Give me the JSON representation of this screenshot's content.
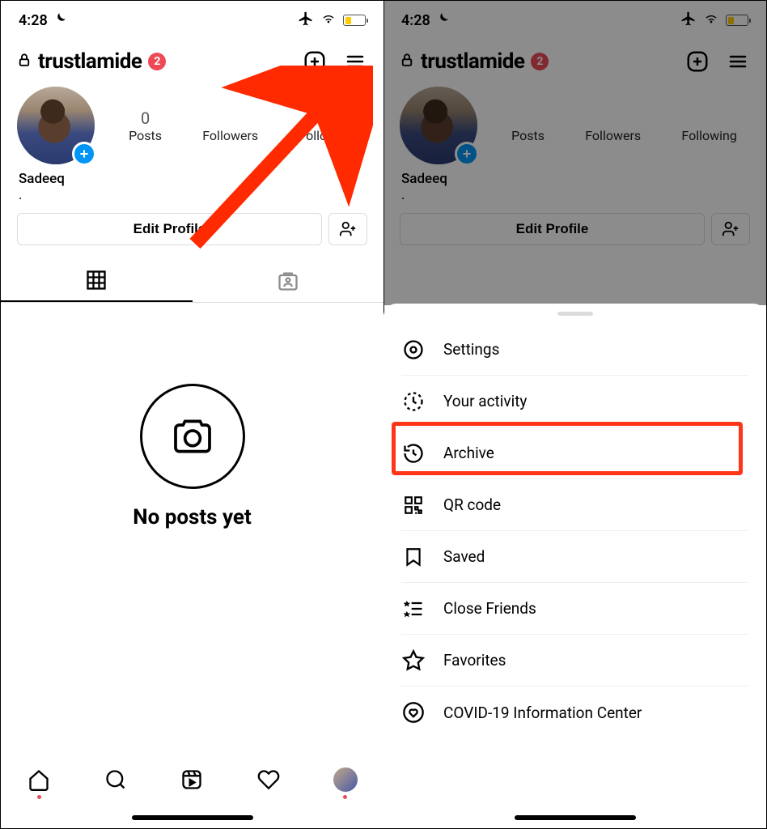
{
  "status": {
    "time": "4:28"
  },
  "header": {
    "username": "trustlamide",
    "badge_count": "2"
  },
  "profile": {
    "display_name": "Sadeeq",
    "bio": "."
  },
  "stats": {
    "posts_count": "0",
    "posts_label": "Posts",
    "followers_label": "Followers",
    "following_label": "Following"
  },
  "buttons": {
    "edit_profile": "Edit Profile"
  },
  "empty": {
    "no_posts": "No posts yet"
  },
  "menu": {
    "settings": "Settings",
    "your_activity": "Your activity",
    "archive": "Archive",
    "qr_code": "QR code",
    "saved": "Saved",
    "close_friends": "Close Friends",
    "favorites": "Favorites",
    "covid": "COVID-19 Information Center"
  }
}
